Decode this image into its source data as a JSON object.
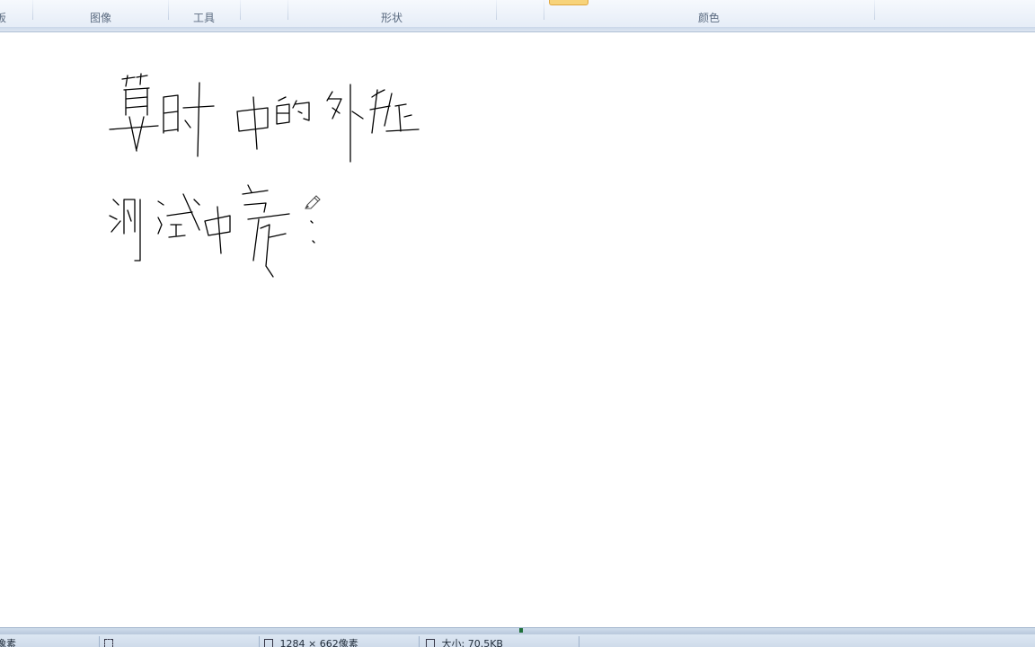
{
  "ribbon": {
    "groups": [
      {
        "label": "板"
      },
      {
        "label": "图像"
      },
      {
        "label": "工具"
      },
      {
        "label": ""
      },
      {
        "label": "形状"
      },
      {
        "label": ""
      },
      {
        "label": "颜色"
      }
    ]
  },
  "canvas": {
    "handwriting_line1": "算时中的外框",
    "handwriting_line2": "测试中文:",
    "tool_cursor": "pencil-icon"
  },
  "statusbar": {
    "cursor_position": "像素",
    "selection_size": "",
    "image_dimensions": "1284 × 662像素",
    "file_size": "大小: 70.5KB"
  },
  "colors": {
    "ribbon_bg": "#e6edf7",
    "ink": "#000000",
    "selected_color_highlight": "#f7d37a",
    "status_bg": "#dde7f3"
  }
}
